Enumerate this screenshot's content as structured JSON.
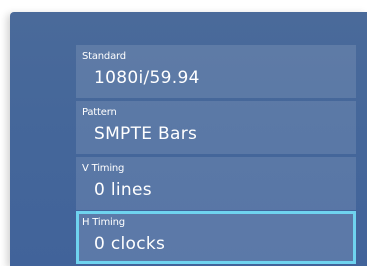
{
  "settings": [
    {
      "label": "Standard",
      "value": "1080i/59.94"
    },
    {
      "label": "Pattern",
      "value": "SMPTE Bars"
    },
    {
      "label": "V Timing",
      "value": "0 lines"
    },
    {
      "label": "H Timing",
      "value": "0 clocks"
    }
  ],
  "colors": {
    "panel": "#45679a",
    "selection_border": "#6fd3ef",
    "text": "#ffffff"
  }
}
